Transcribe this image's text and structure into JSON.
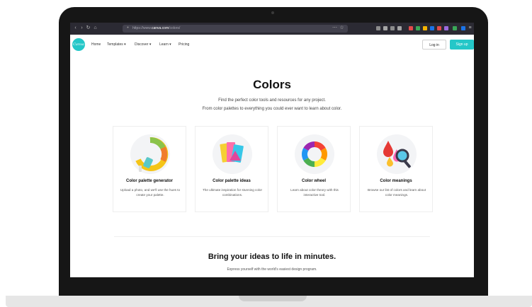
{
  "browser": {
    "url_prefix": "https://www.",
    "url_domain": "canva.com",
    "url_path": "/colors/"
  },
  "nav": {
    "logo_text": "Canva",
    "items": [
      "Home",
      "Templates ▾",
      "Discover ▾",
      "Learn ▾",
      "Pricing"
    ],
    "login": "Log in",
    "signup": "Sign up"
  },
  "hero": {
    "title": "Colors",
    "line1": "Find the perfect color tools and resources for any project.",
    "line2": "From color palettes to everything you could ever want to learn about color."
  },
  "cards": [
    {
      "title": "Color palette generator",
      "desc": "Upload a photo, and we'll use the hues to create your palette.",
      "icon": "paint-roller-icon"
    },
    {
      "title": "Color palette ideas",
      "desc": "The ultimate inspiration for stunning color combinations.",
      "icon": "palette-swatches-icon"
    },
    {
      "title": "Color wheel",
      "desc": "Learn about color theory with this interactive tool.",
      "icon": "color-wheel-icon"
    },
    {
      "title": "Color meanings",
      "desc": "Browse our list of colors and learn about color meanings.",
      "icon": "magnifier-drops-icon"
    }
  ],
  "bottom": {
    "title": "Bring your ideas to life in minutes.",
    "subtitle": "Express yourself with the world's easiest design program."
  },
  "colors": {
    "accent": "#24c7c8",
    "browser_chrome": "#2b2a33",
    "laptop_bezel": "#161616"
  }
}
